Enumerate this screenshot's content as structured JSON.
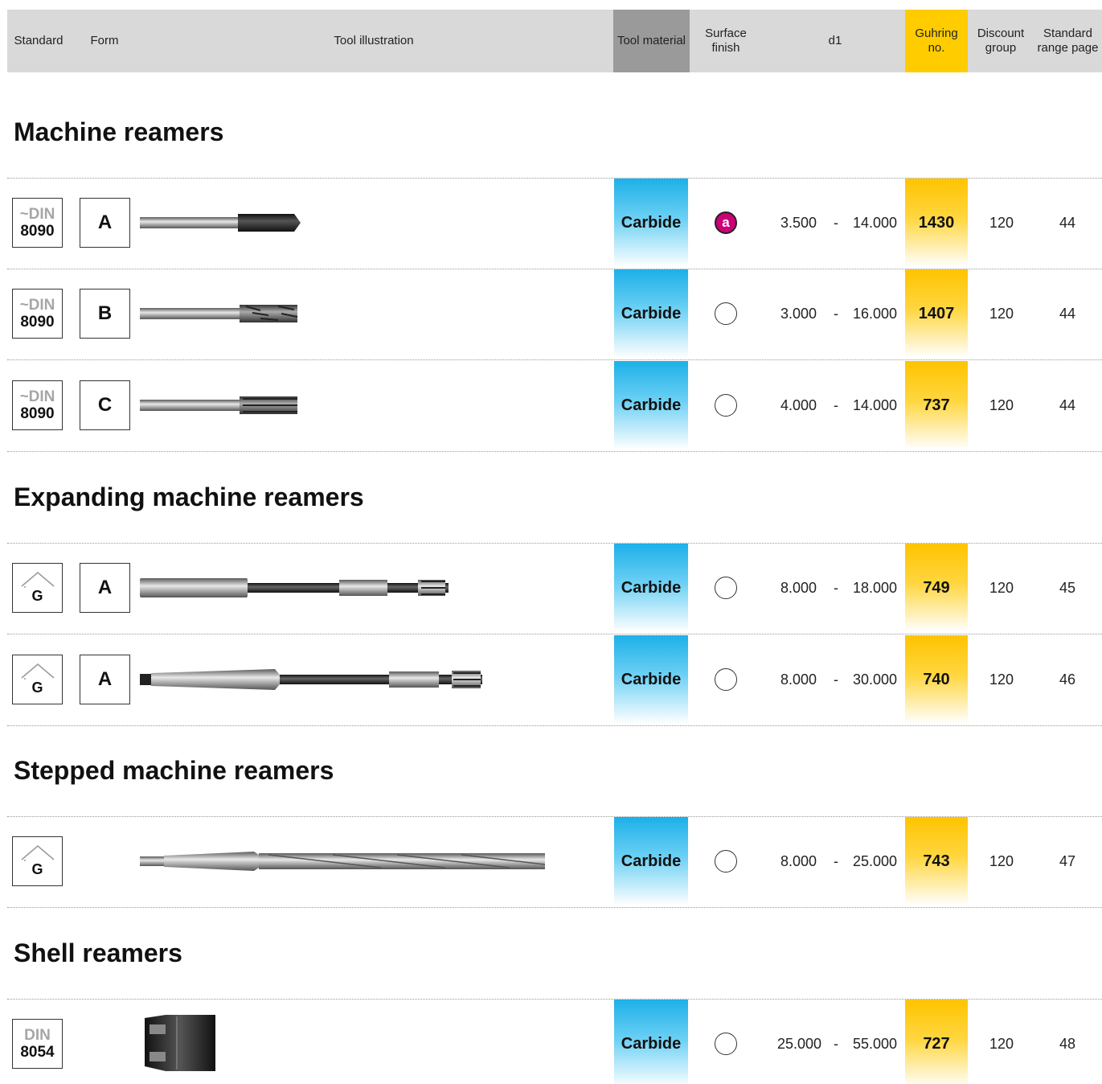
{
  "header": {
    "standard": "Standard",
    "form": "Form",
    "tool_illustration": "Tool illustration",
    "tool_material": "Tool material",
    "surface_finish_line1": "Surface",
    "surface_finish_line2": "finish",
    "d1": "d1",
    "guhring_line1": "Guhring",
    "guhring_line2": "no.",
    "discount_line1": "Discount",
    "discount_line2": "group",
    "range_line1": "Standard",
    "range_line2": "range page"
  },
  "sections": [
    {
      "title": "Machine reamers"
    },
    {
      "title": "Expanding machine reamers"
    },
    {
      "title": "Stepped machine reamers"
    },
    {
      "title": "Shell reamers"
    }
  ],
  "rows": [
    {
      "standard_top": "~DIN",
      "standard_bottom": "8090",
      "form": "A",
      "material": "Carbide",
      "surface": "a",
      "d1_from": "3.500",
      "dash": "-",
      "d1_to": "14.000",
      "guhring_no": "1430",
      "discount": "120",
      "range_page": "44"
    },
    {
      "standard_top": "~DIN",
      "standard_bottom": "8090",
      "form": "B",
      "material": "Carbide",
      "surface": "",
      "d1_from": "3.000",
      "dash": "-",
      "d1_to": "16.000",
      "guhring_no": "1407",
      "discount": "120",
      "range_page": "44"
    },
    {
      "standard_top": "~DIN",
      "standard_bottom": "8090",
      "form": "C",
      "material": "Carbide",
      "surface": "",
      "d1_from": "4.000",
      "dash": "-",
      "d1_to": "14.000",
      "guhring_no": "737",
      "discount": "120",
      "range_page": "44"
    },
    {
      "standard_g": "G",
      "form": "A",
      "material": "Carbide",
      "surface": "",
      "d1_from": "8.000",
      "dash": "-",
      "d1_to": "18.000",
      "guhring_no": "749",
      "discount": "120",
      "range_page": "45"
    },
    {
      "standard_g": "G",
      "form": "A",
      "material": "Carbide",
      "surface": "",
      "d1_from": "8.000",
      "dash": "-",
      "d1_to": "30.000",
      "guhring_no": "740",
      "discount": "120",
      "range_page": "46"
    },
    {
      "standard_g": "G",
      "material": "Carbide",
      "surface": "",
      "d1_from": "8.000",
      "dash": "-",
      "d1_to": "25.000",
      "guhring_no": "743",
      "discount": "120",
      "range_page": "47"
    },
    {
      "standard_top": "DIN",
      "standard_bottom": "8054",
      "material": "Carbide",
      "surface": "",
      "d1_from": "25.000",
      "dash": "-",
      "d1_to": "55.000",
      "guhring_no": "727",
      "discount": "120",
      "range_page": "48"
    }
  ],
  "colors": {
    "header_bg": "#d9d9d9",
    "material_header_bg": "#9a9a9a",
    "guhring_header_bg": "#ffcc00",
    "material_cell": "#1cb0e8",
    "guhring_cell": "#ffc400",
    "surface_fill": "#cc0077"
  },
  "icons": {
    "surface_finish": "surface-finish-circle-icon",
    "guhring_standard": "guhring-house-icon"
  }
}
